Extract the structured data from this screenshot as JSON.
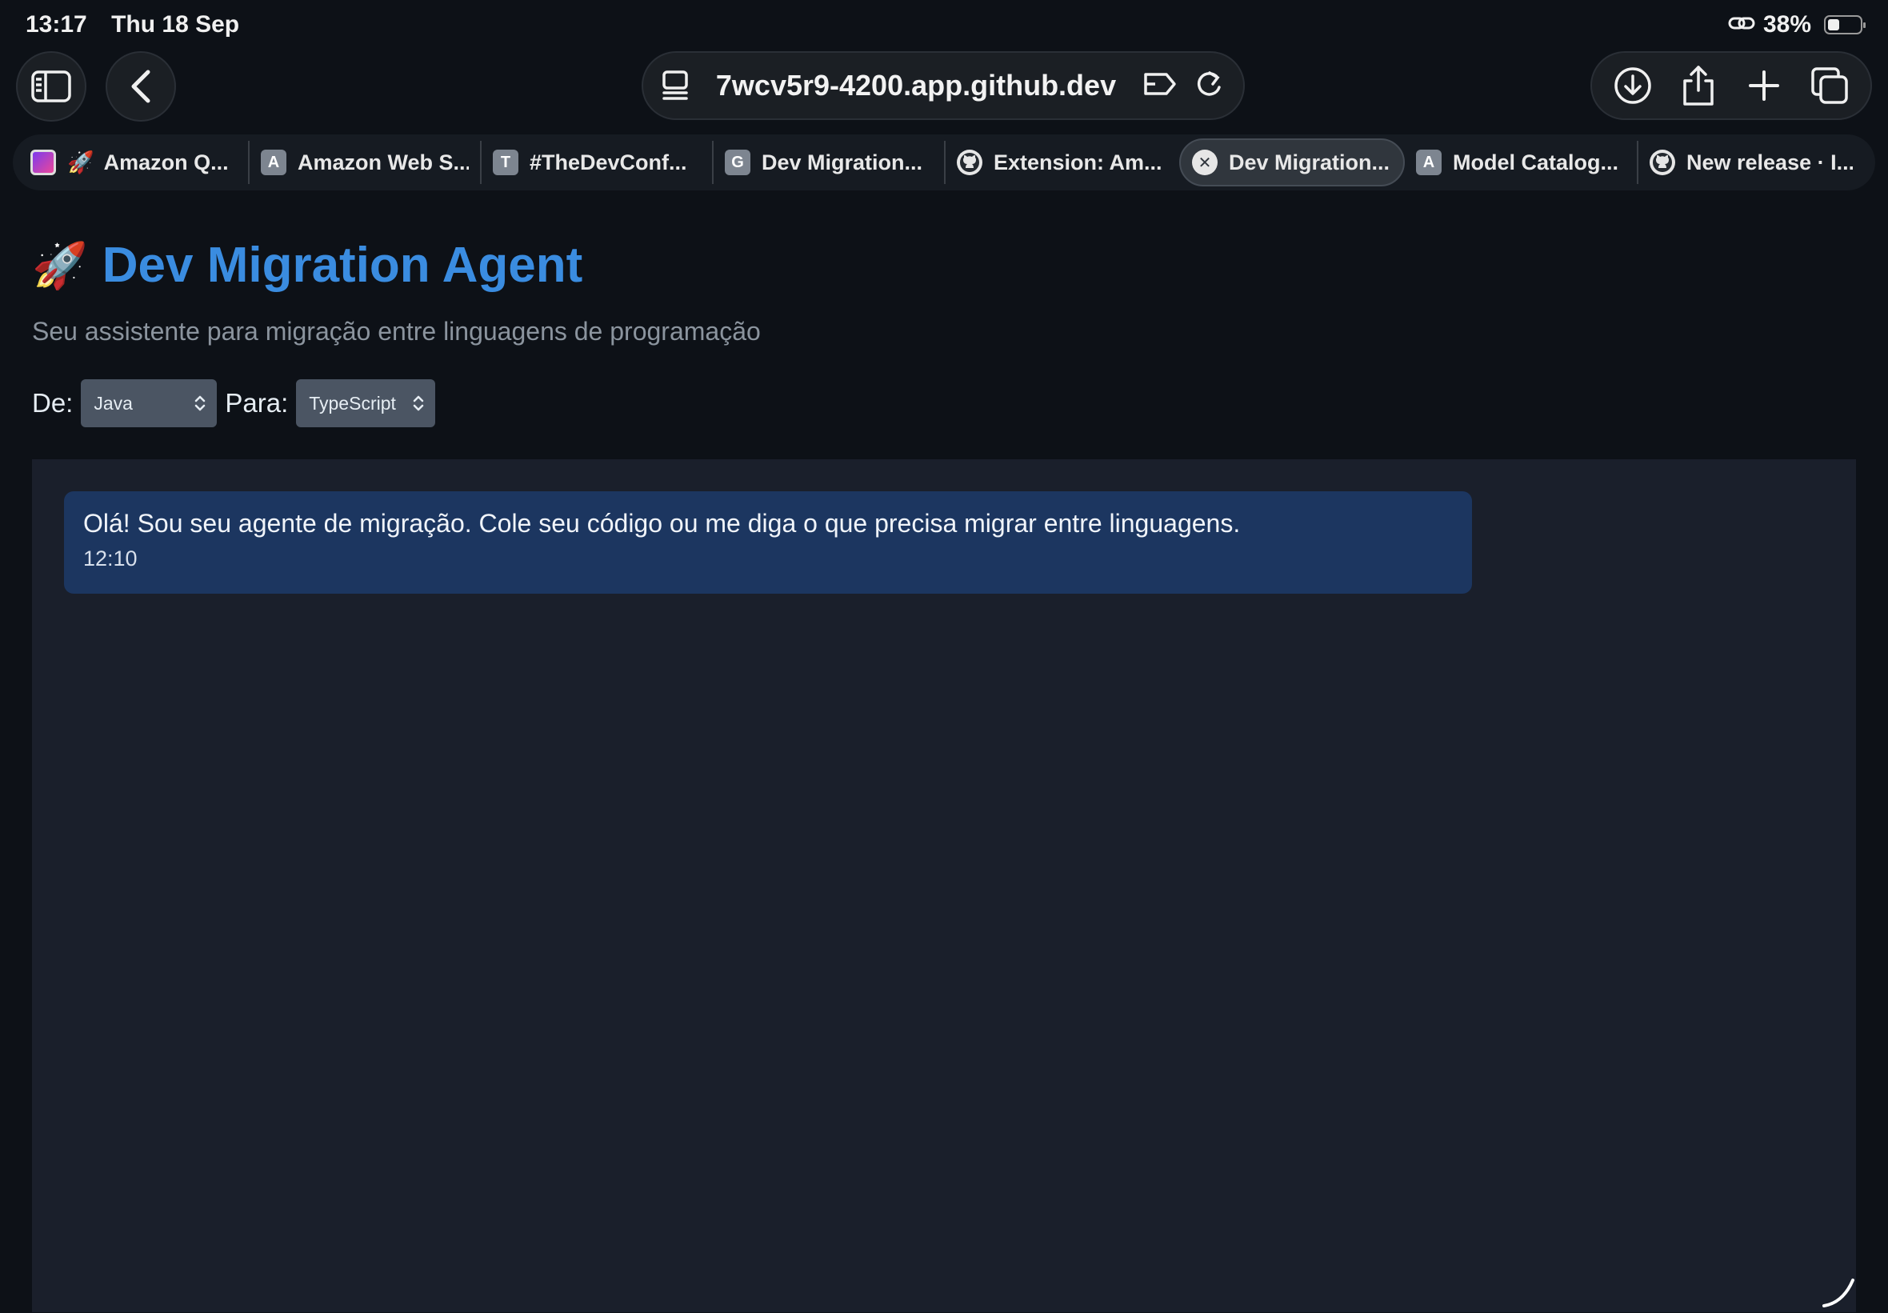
{
  "status_bar": {
    "time": "13:17",
    "date": "Thu 18 Sep",
    "battery": "38%"
  },
  "browser": {
    "url": "7wcv5r9-4200.app.github.dev",
    "tabs": [
      {
        "icon": "q",
        "prefix": "🚀",
        "title": "Amazon Q..."
      },
      {
        "icon": "letter",
        "letter": "A",
        "title": "Amazon Web S..."
      },
      {
        "icon": "letter",
        "letter": "T",
        "title": "#TheDevConf..."
      },
      {
        "icon": "letter",
        "letter": "G",
        "title": "Dev Migration..."
      },
      {
        "icon": "gh",
        "title": "Extension: Am..."
      },
      {
        "icon": "close",
        "title": "Dev Migration...",
        "active": true
      },
      {
        "icon": "letter",
        "letter": "A",
        "title": "Model Catalog..."
      },
      {
        "icon": "gh",
        "title": "New release · I..."
      }
    ]
  },
  "page": {
    "rocket": "🚀",
    "title": "Dev Migration Agent",
    "subtitle": "Seu assistente para migração entre linguagens de programação",
    "from_label": "De:",
    "from_value": "Java",
    "to_label": "Para:",
    "to_value": "TypeScript"
  },
  "chat": {
    "messages": [
      {
        "text": "Olá! Sou seu agente de migração. Cole seu código ou me diga o que precisa migrar entre linguagens.",
        "time": "12:10"
      }
    ]
  },
  "colors": {
    "title": "#3a8ce0",
    "bubble": "#1c3660",
    "panel": "#1a1f2b",
    "background": "#0d1117"
  }
}
